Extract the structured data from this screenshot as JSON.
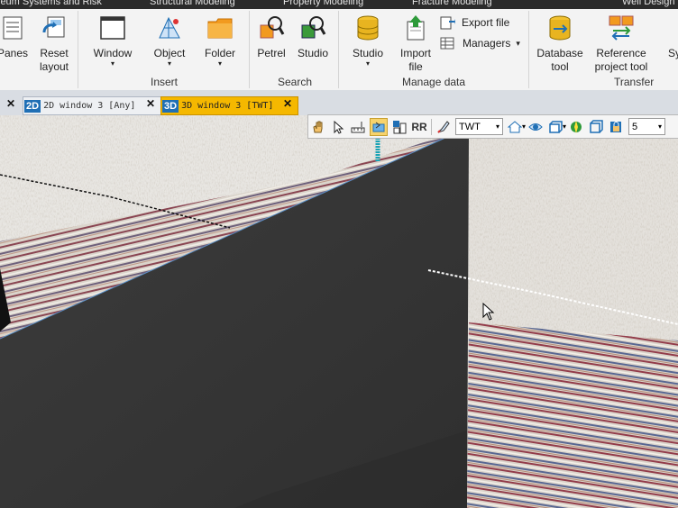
{
  "top_menu": [
    "leum Systems and Risk",
    "Structural Modeling",
    "Property Modeling",
    "Fracture Modeling",
    "Well Design"
  ],
  "ribbon": {
    "panes_label": "Panes",
    "reset_layout_label": "Reset\nlayout",
    "window_label": "Window",
    "object_label": "Object",
    "folder_label": "Folder",
    "insert_group": "Insert",
    "petrel_label": "Petrel",
    "studio_search_label": "Studio",
    "search_group": "Search",
    "studio_label": "Studio",
    "import_file_label": "Import\nfile",
    "export_file_label": "Export file",
    "managers_label": "Managers",
    "manage_data_group": "Manage data",
    "database_tool_label": "Database\ntool",
    "reference_project_tool_label": "Reference\nproject tool",
    "sy_label": "Sy",
    "transfer_group": "Transfer"
  },
  "tabs": [
    {
      "badge": "2D",
      "label": "2D window 3 [Any]",
      "active": false
    },
    {
      "badge": "3D",
      "label": "3D window 3 [TWT]",
      "active": true
    }
  ],
  "toolbar3d": {
    "domain_select": "TWT",
    "zscale_select": "5"
  },
  "colors": {
    "ribbon_bg": "#f3f3f3",
    "active_tab": "#f5b800",
    "badge_blue": "#1f6fb5"
  }
}
